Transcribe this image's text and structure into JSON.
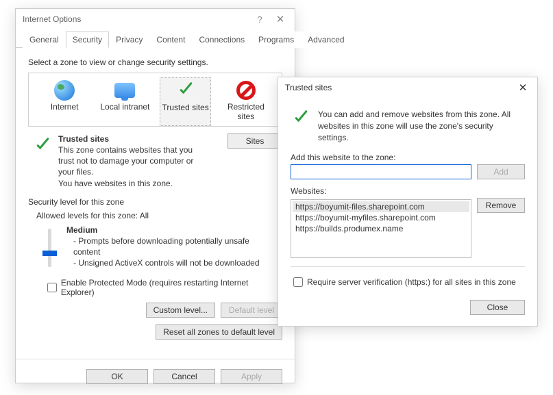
{
  "main": {
    "title": "Internet Options",
    "helpGlyph": "?",
    "closeGlyph": "✕",
    "tabs": [
      "General",
      "Security",
      "Privacy",
      "Content",
      "Connections",
      "Programs",
      "Advanced"
    ],
    "activeTab": "Security",
    "selectPrompt": "Select a zone to view or change security settings.",
    "zones": [
      {
        "label": "Internet"
      },
      {
        "label": "Local intranet"
      },
      {
        "label": "Trusted sites"
      },
      {
        "label": "Restricted sites"
      }
    ],
    "selectedZone": "Trusted sites",
    "zoneDesc": {
      "title": "Trusted sites",
      "line1": "This zone contains websites that you trust not to damage your computer or your files.",
      "line2": "You have websites in this zone."
    },
    "sitesBtn": "Sites",
    "secLevelLabel": "Security level for this zone",
    "allowedLevels": "Allowed levels for this zone: All",
    "level": {
      "name": "Medium",
      "b1": "- Prompts before downloading potentially unsafe content",
      "b2": "- Unsigned ActiveX controls will not be downloaded"
    },
    "protectedMode": "Enable Protected Mode (requires restarting Internet Explorer)",
    "customLevelBtn": "Custom level...",
    "defaultLevelBtn": "Default level",
    "resetBtn": "Reset all zones to default level",
    "ok": "OK",
    "cancel": "Cancel",
    "apply": "Apply"
  },
  "popup": {
    "title": "Trusted sites",
    "closeGlyph": "✕",
    "intro": "You can add and remove websites from this zone. All websites in this zone will use the zone's security settings.",
    "addLabel": "Add this website to the zone:",
    "addBtn": "Add",
    "websitesLabel": "Websites:",
    "sites": [
      "https://boyumit-files.sharepoint.com",
      "https://boyumit-myfiles.sharepoint.com",
      "https://builds.produmex.name"
    ],
    "selectedSite": "https://boyumit-files.sharepoint.com",
    "removeBtn": "Remove",
    "requireHttps": "Require server verification (https:) for all sites in this zone",
    "closeBtn": "Close"
  }
}
